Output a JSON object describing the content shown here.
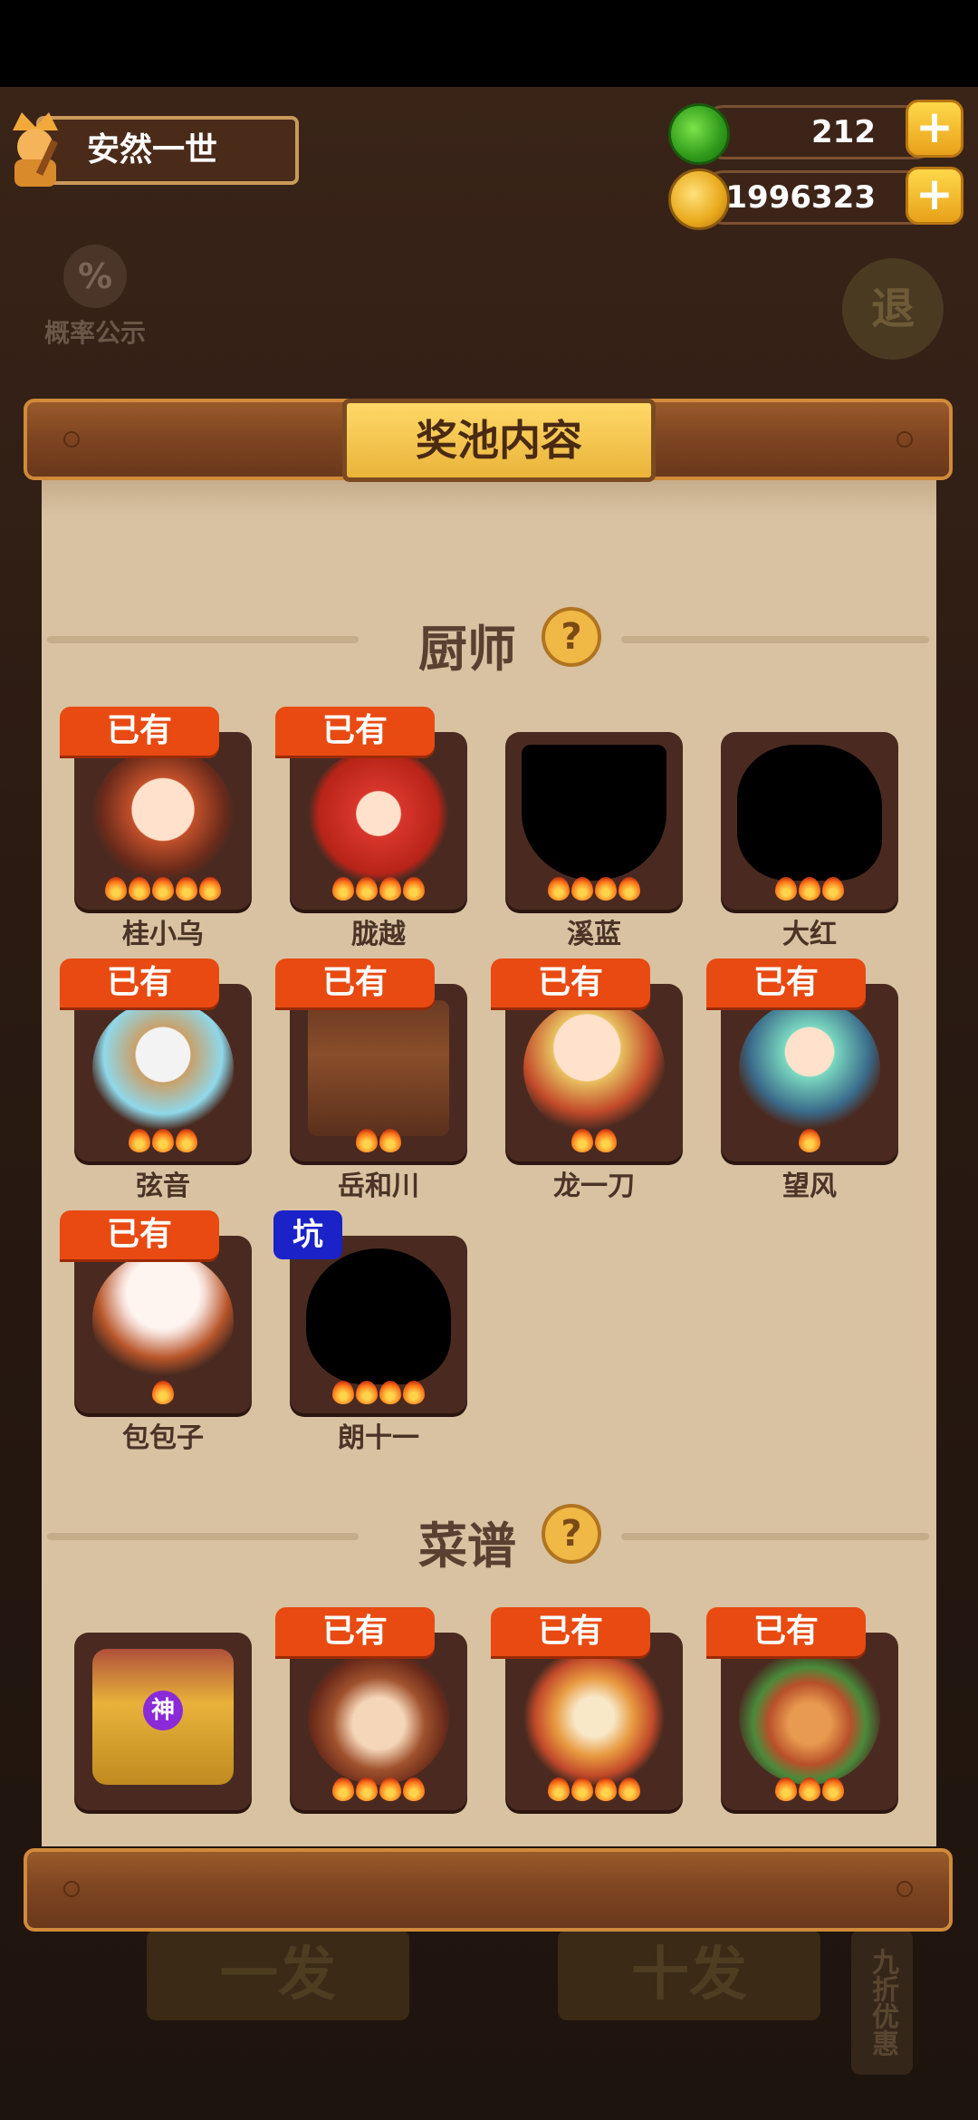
{
  "player": {
    "name": "安然一世"
  },
  "currency": {
    "jade": "212",
    "coins": "1996323"
  },
  "background": {
    "probability_label": "概率公示",
    "exit_label": "退",
    "single_draw": "一发",
    "ten_draw": "十发",
    "discount": "九折优惠"
  },
  "panel": {
    "title": "奖池内容",
    "chef_section": "厨师",
    "recipe_section": "菜谱",
    "chefs": [
      {
        "name": "桂小乌",
        "badge": "已有",
        "stars": 5
      },
      {
        "name": "胧越",
        "badge": "已有",
        "stars": 4
      },
      {
        "name": "溪蓝",
        "badge": "",
        "stars": 4
      },
      {
        "name": "大红",
        "badge": "",
        "stars": 3
      },
      {
        "name": "弦音",
        "badge": "已有",
        "stars": 3
      },
      {
        "name": "岳和川",
        "badge": "已有",
        "stars": 2
      },
      {
        "name": "龙一刀",
        "badge": "已有",
        "stars": 2
      },
      {
        "name": "望风",
        "badge": "已有",
        "stars": 1
      },
      {
        "name": "包包子",
        "badge": "已有",
        "stars": 1
      },
      {
        "name": "朗十一",
        "badge": "坑",
        "stars": 4
      }
    ],
    "recipes": [
      {
        "badge": "",
        "tag": "神"
      },
      {
        "badge": "已有"
      },
      {
        "badge": "已有"
      },
      {
        "badge": "已有"
      }
    ]
  },
  "colors": {
    "owned_badge": "#e84a12",
    "pit_badge": "#1a22c8",
    "paper": "#d8c2a2"
  }
}
